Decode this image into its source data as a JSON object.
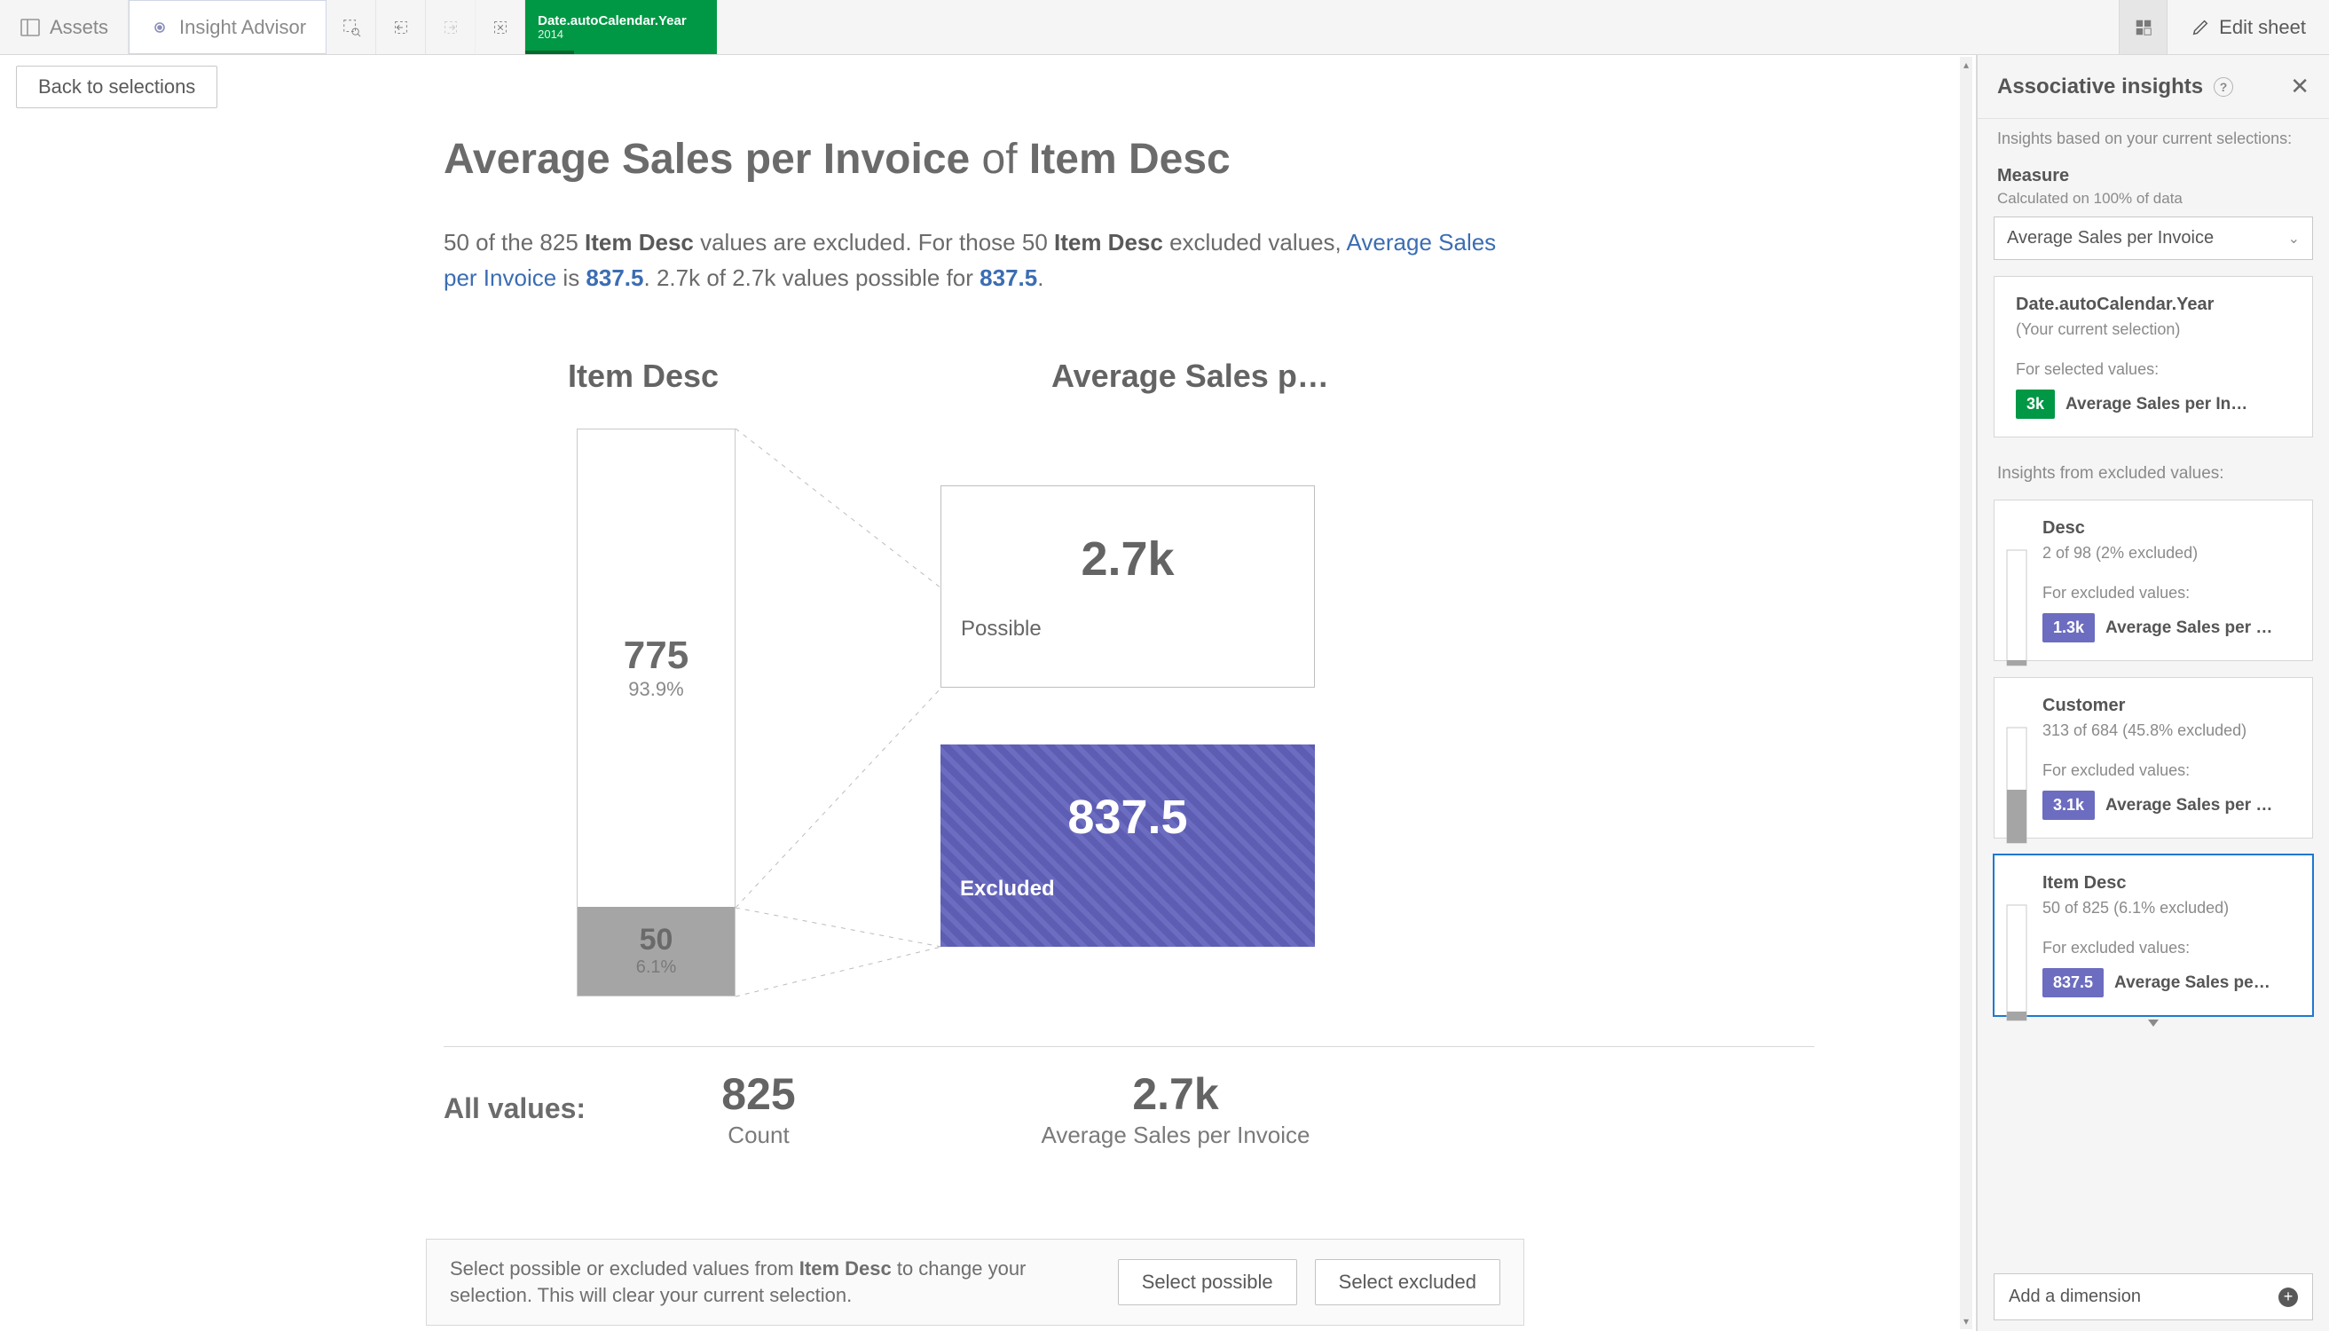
{
  "toolbar": {
    "assets": "Assets",
    "insight": "Insight Advisor",
    "selection_field": "Date.autoCalendar.Year",
    "selection_value": "2014",
    "edit": "Edit sheet"
  },
  "subbar": {
    "back": "Back to selections"
  },
  "main": {
    "title_measure": "Average Sales per Invoice",
    "title_of": "of",
    "title_dim": "Item Desc",
    "explain": {
      "p1a": "50 of the 825 ",
      "p1b": "Item Desc",
      "p1c": " values are excluded. For those 50 ",
      "p1d": "Item Desc",
      "p1e": " excluded values, ",
      "p1f": "Average Sales per Invoice",
      "p1g": " is ",
      "p1h": "837.5",
      "p1i": ". 2.7k of 2.7k values possible for ",
      "p1j": "837.5",
      "p1k": "."
    },
    "viz": {
      "dim_header": "Item Desc",
      "measure_header": "Average Sales per I…",
      "possible_count": "775",
      "possible_pct": "93.9%",
      "excluded_count": "50",
      "excluded_pct": "6.1%",
      "possible_value": "2.7k",
      "possible_label": "Possible",
      "excluded_value": "837.5",
      "excluded_label": "Excluded"
    },
    "allvalues": {
      "label": "All values:",
      "count_n": "825",
      "count_l": "Count",
      "avg_n": "2.7k",
      "avg_l": "Average Sales per Invoice"
    },
    "footer": {
      "text_a": "Select possible or excluded values from ",
      "text_b": "Item Desc",
      "text_c": " to change your selection. This will clear your current selection.",
      "btn_possible": "Select possible",
      "btn_excluded": "Select excluded"
    }
  },
  "panel": {
    "title": "Associative insights",
    "note": "Insights based on your current selections:",
    "measure_title": "Measure",
    "measure_sub": "Calculated on 100% of data",
    "measure_value": "Average Sales per Invoice",
    "selection_card": {
      "title": "Date.autoCalendar.Year",
      "sub": "(Your current selection)",
      "for": "For selected values:",
      "chip": "3k",
      "metric": "Average Sales per In…"
    },
    "excluded_header": "Insights from excluded values:",
    "cards": [
      {
        "title": "Desc",
        "sub": "2 of 98 (2% excluded)",
        "for": "For excluded values:",
        "chip": "1.3k",
        "metric": "Average Sales per …"
      },
      {
        "title": "Customer",
        "sub": "313 of 684 (45.8% excluded)",
        "for": "For excluded values:",
        "chip": "3.1k",
        "metric": "Average Sales per …"
      },
      {
        "title": "Item Desc",
        "sub": "50 of 825 (6.1% excluded)",
        "for": "For excluded values:",
        "chip": "837.5",
        "metric": "Average Sales pe…"
      }
    ],
    "add": "Add a dimension"
  },
  "chart_data": {
    "type": "bar",
    "dimension": "Item Desc",
    "measure": "Average Sales per Invoice",
    "breakdown": {
      "possible": {
        "count": 775,
        "pct": 93.9,
        "measure_value": "2.7k"
      },
      "excluded": {
        "count": 50,
        "pct": 6.1,
        "measure_value": 837.5
      }
    },
    "totals": {
      "count": 825,
      "measure_value": "2.7k"
    }
  }
}
